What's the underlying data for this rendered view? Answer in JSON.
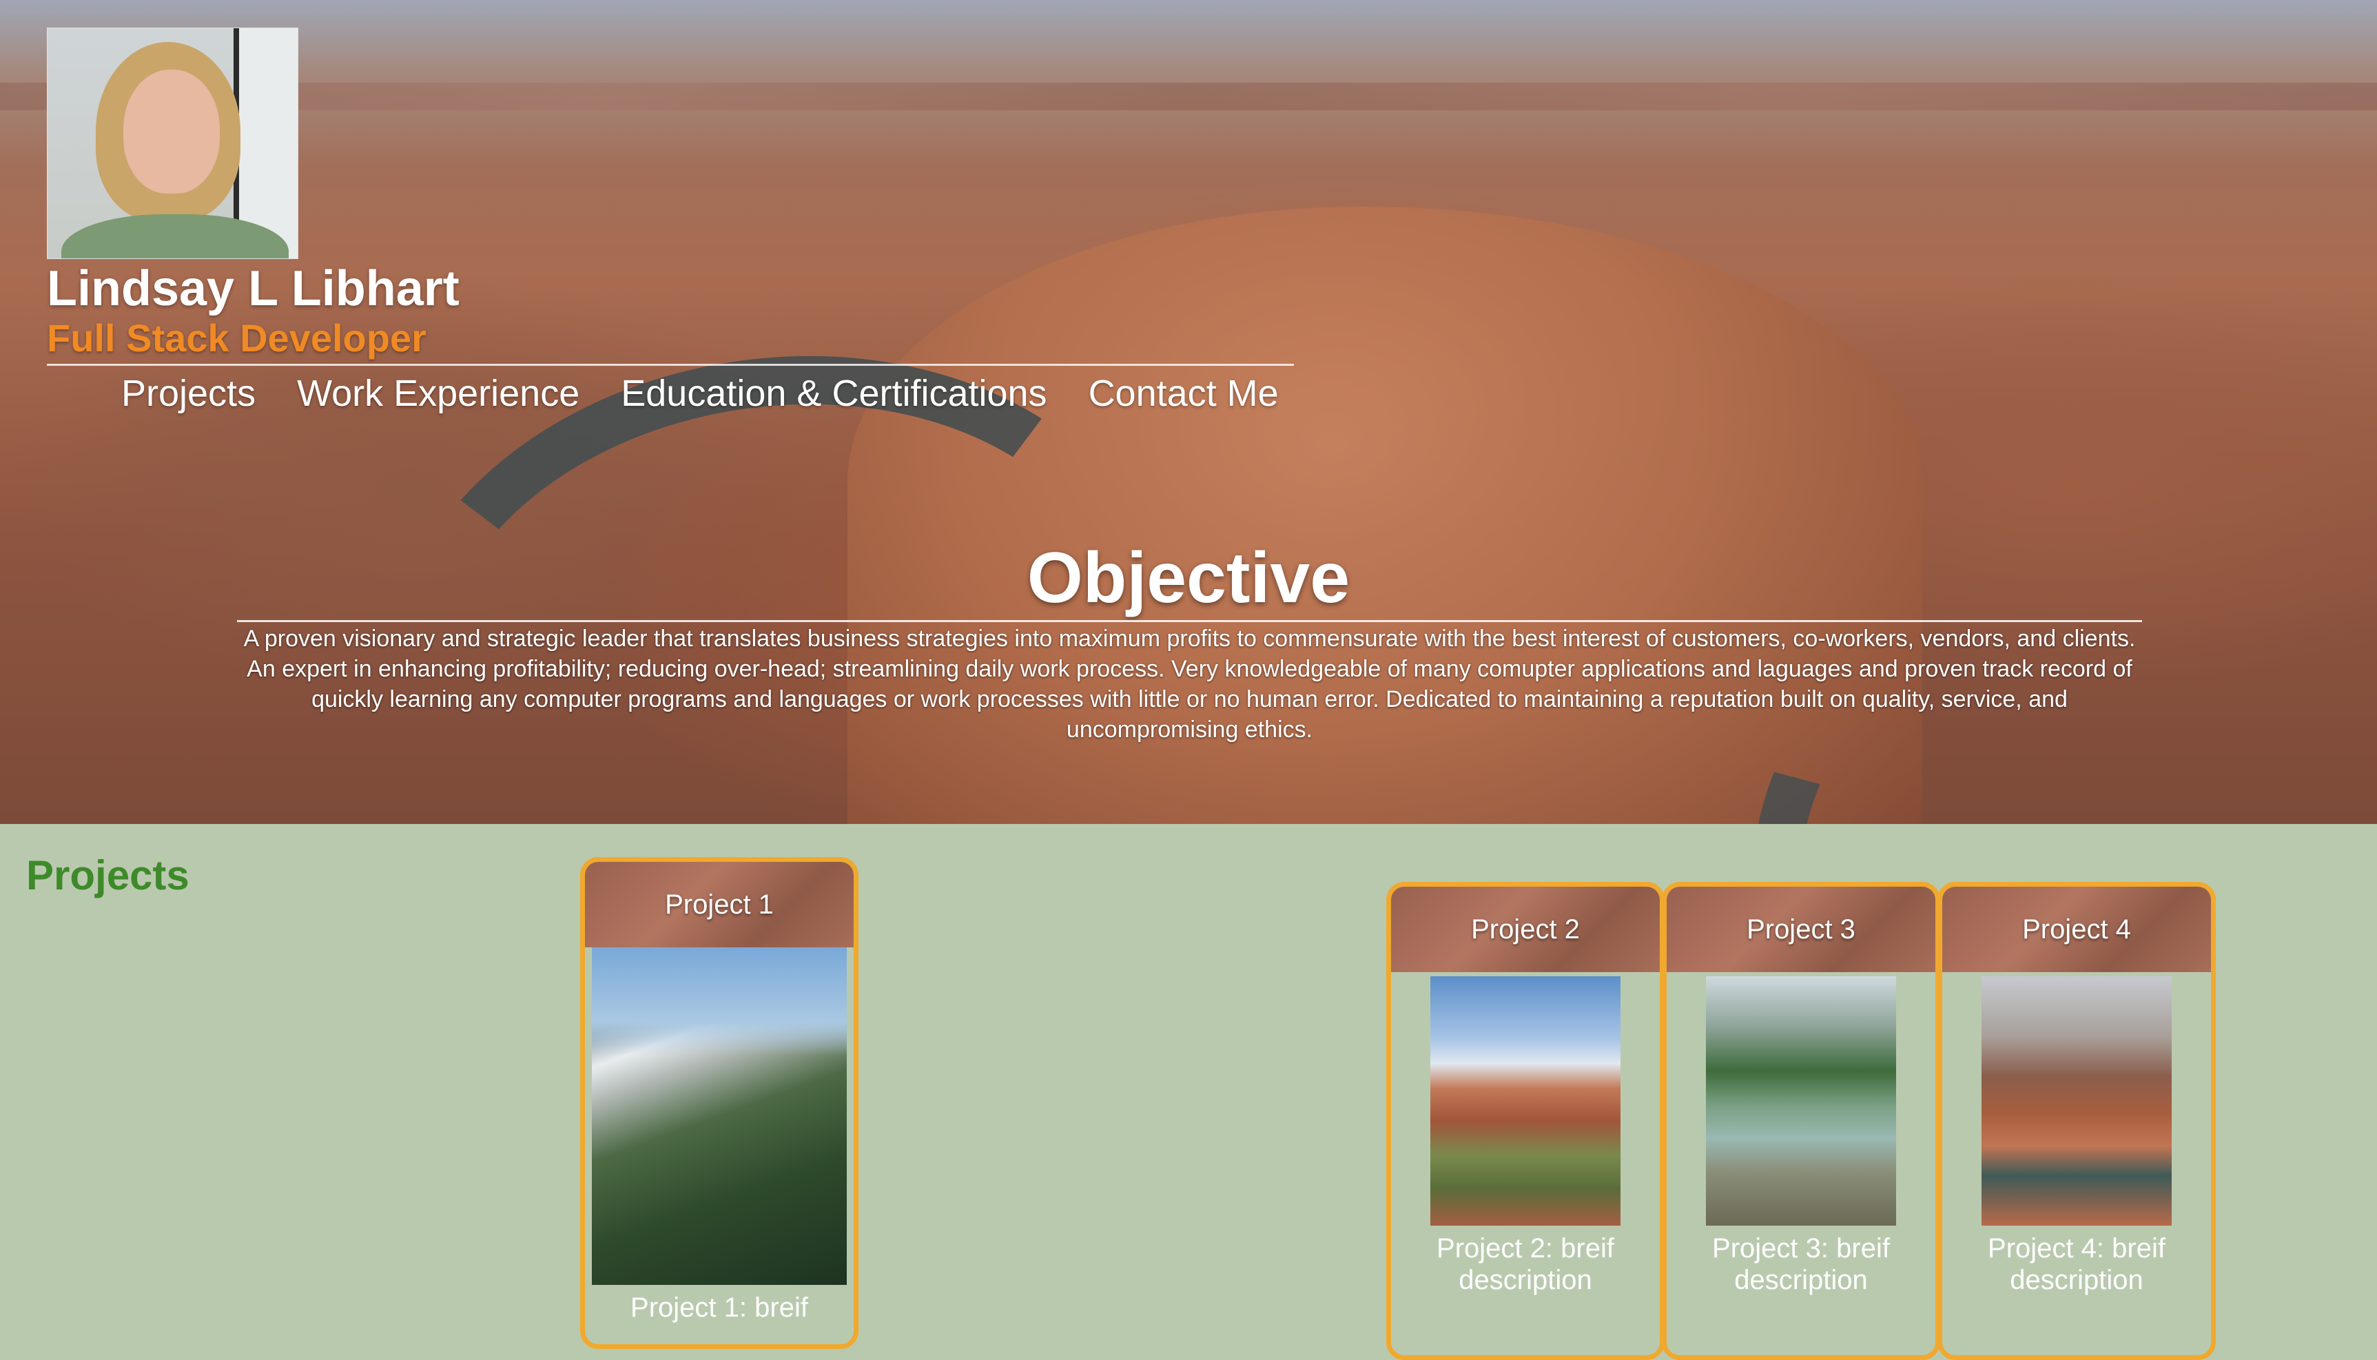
{
  "profile": {
    "name": "Lindsay L Libhart",
    "role": "Full Stack Developer"
  },
  "nav": {
    "items": [
      "Projects",
      "Work Experience",
      "Education & Certifications",
      "Contact Me"
    ]
  },
  "objective": {
    "title": "Objective",
    "text": "A proven visionary and strategic leader that translates business strategies into maximum profits to commensurate with the best interest of customers, co-workers, vendors, and clients. An expert in enhancing profitability; reducing over-head; streamlining daily work process. Very knowledgeable of many comupter applications and laguages and proven track record of quickly learning any computer programs and languages or work processes with little or no human error. Dedicated to maintaining a reputation built on quality, service, and uncompromising ethics."
  },
  "projects": {
    "heading": "Projects",
    "cards": [
      {
        "title": "Project 1",
        "desc": "Project 1: breif"
      },
      {
        "title": "Project 2",
        "desc": "Project 2: breif description"
      },
      {
        "title": "Project 3",
        "desc": "Project 3: breif description"
      },
      {
        "title": "Project 4",
        "desc": "Project 4: breif description"
      }
    ]
  },
  "colors": {
    "accent_orange": "#f08a24",
    "card_border": "#f0a92e",
    "heading_green": "#3e8a2a",
    "page_bg": "#b9c9ae"
  }
}
